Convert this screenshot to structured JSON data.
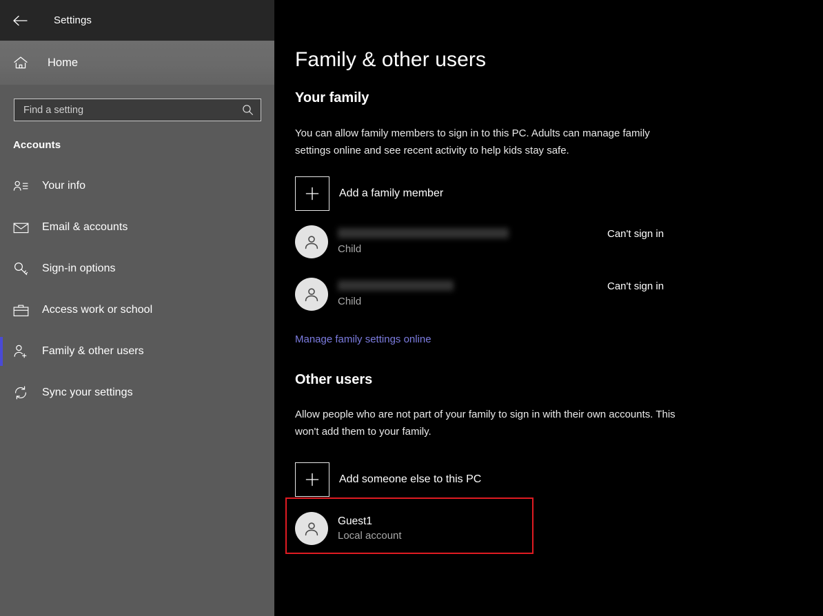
{
  "window": {
    "title": "Settings",
    "back_icon": "back-arrow-icon"
  },
  "sidebar": {
    "home": {
      "label": "Home",
      "icon": "home-icon"
    },
    "search": {
      "placeholder": "Find a setting",
      "value": "",
      "icon": "search-icon"
    },
    "category": "Accounts",
    "selected_index": 4,
    "accent_color": "#4a4ad6",
    "items": [
      {
        "label": "Your info",
        "icon": "user-card-icon",
        "selected": false
      },
      {
        "label": "Email & accounts",
        "icon": "envelope-icon",
        "selected": false
      },
      {
        "label": "Sign-in options",
        "icon": "key-icon",
        "selected": false
      },
      {
        "label": "Access work or school",
        "icon": "briefcase-icon",
        "selected": false
      },
      {
        "label": "Family & other users",
        "icon": "add-person-icon",
        "selected": true
      },
      {
        "label": "Sync your settings",
        "icon": "sync-icon",
        "selected": false
      }
    ]
  },
  "main": {
    "page_title": "Family & other users",
    "your_family": {
      "heading": "Your family",
      "description": "You can allow family members to sign in to this PC. Adults can manage family settings online and see recent activity to help kids stay safe.",
      "add_member": {
        "label": "Add a family member",
        "icon": "plus-icon"
      },
      "members": [
        {
          "name": "",
          "name_redacted": true,
          "redacted_width": 248,
          "role": "Child",
          "status": "Can't sign in",
          "avatar": "person-avatar-icon"
        },
        {
          "name": "",
          "name_redacted": true,
          "redacted_width": 168,
          "role": "Child",
          "status": "Can't sign in",
          "avatar": "person-avatar-icon"
        }
      ],
      "manage_link": "Manage family settings online"
    },
    "other_users": {
      "heading": "Other users",
      "description": "Allow people who are not part of your family to sign in with their own accounts. This won't add them to your family.",
      "add_someone": {
        "label": "Add someone else to this PC",
        "icon": "plus-icon"
      },
      "accounts": [
        {
          "name": "Guest1",
          "type": "Local account",
          "avatar": "person-avatar-icon"
        }
      ]
    }
  },
  "annotation": {
    "color": "#e01b22",
    "target": "add-someone-else-to-this-pc-row"
  }
}
